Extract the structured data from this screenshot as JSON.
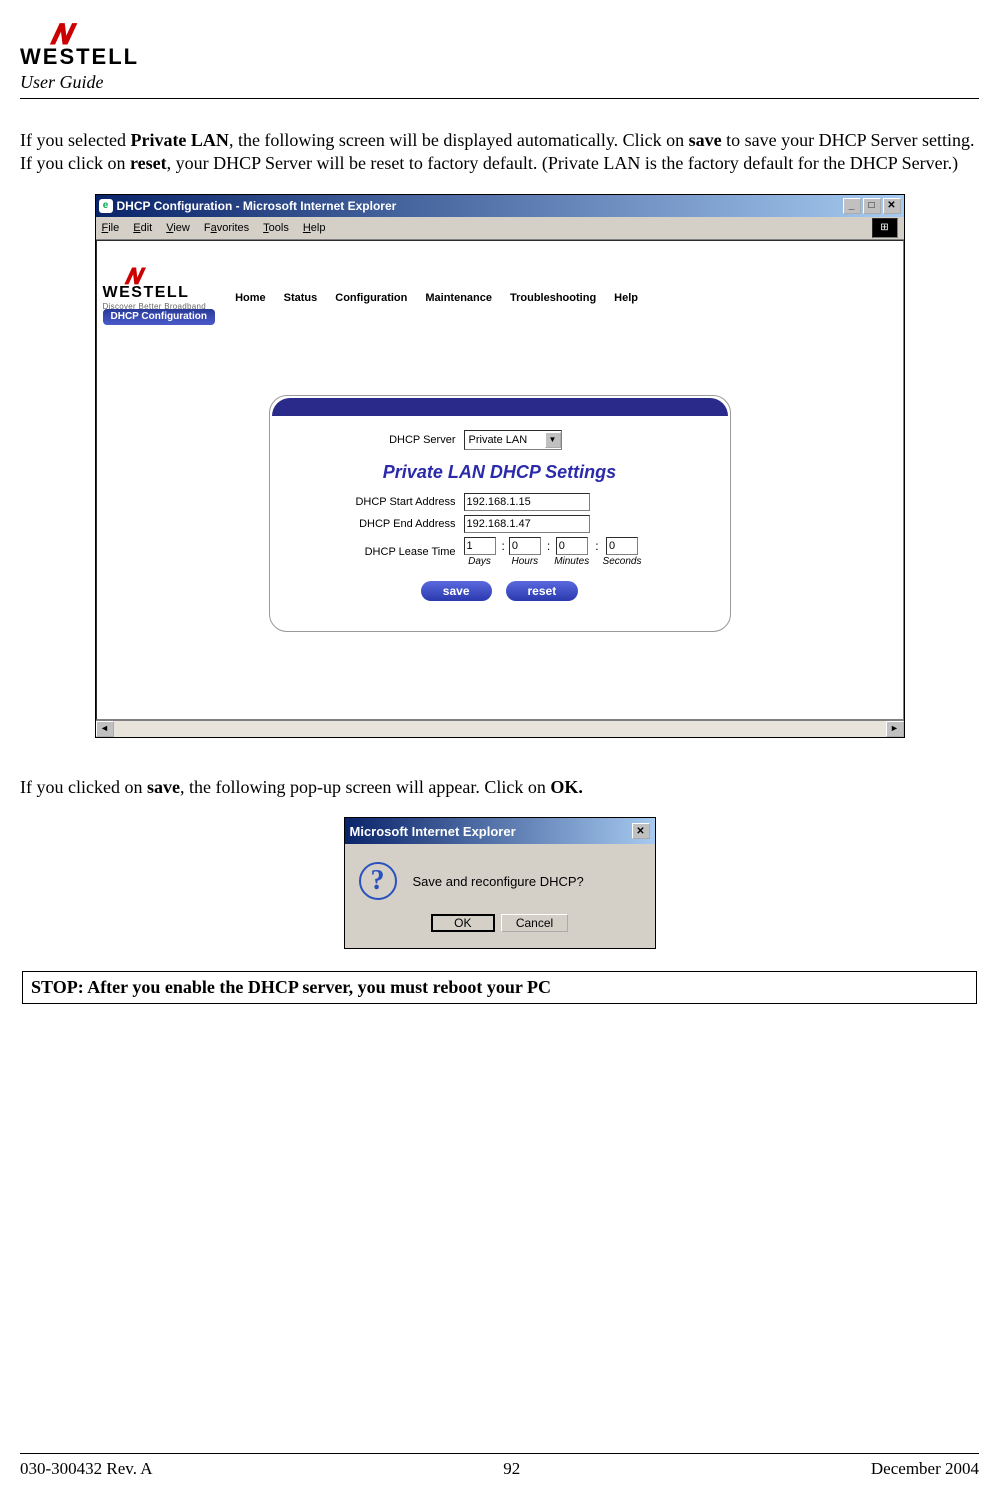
{
  "header": {
    "brand": "WESTELL",
    "doc_label": "User Guide"
  },
  "paragraphs": {
    "p1_pre": "If you selected ",
    "p1_b1": "Private LAN",
    "p1_mid1": ", the following screen will be displayed automatically. Click on ",
    "p1_b2": "save",
    "p1_mid2": " to save your DHCP Server setting. If you click on ",
    "p1_b3": "reset",
    "p1_post": ", your DHCP Server will be reset to factory default. (Private LAN is the factory default for the DHCP Server.)",
    "p2_pre": "If you clicked on ",
    "p2_b1": "save",
    "p2_mid": ", the following pop-up screen will appear. Click on ",
    "p2_b2": "OK."
  },
  "stop_note": "STOP: After you enable the DHCP server, you must reboot your PC",
  "ie_window": {
    "title": "DHCP Configuration - Microsoft Internet Explorer",
    "menus": {
      "file": "File",
      "edit": "Edit",
      "view": "View",
      "favorites": "Favorites",
      "tools": "Tools",
      "help": "Help"
    },
    "logo_brand": "WESTELL",
    "logo_tagline": "Discover Better Broadband",
    "nav": {
      "home": "Home",
      "status": "Status",
      "config": "Configuration",
      "maint": "Maintenance",
      "trouble": "Troubleshooting",
      "help": "Help"
    },
    "sub_tab": "DHCP Configuration",
    "panel": {
      "dhcp_server_label": "DHCP Server",
      "dhcp_server_value": "Private LAN",
      "heading": "Private LAN DHCP Settings",
      "start_label": "DHCP Start Address",
      "start_value": "192.168.1.15",
      "end_label": "DHCP End Address",
      "end_value": "192.168.1.47",
      "lease_label": "DHCP Lease Time",
      "lease": {
        "days": "1",
        "days_unit": "Days",
        "hours": "0",
        "hours_unit": "Hours",
        "minutes": "0",
        "minutes_unit": "Minutes",
        "seconds": "0",
        "seconds_unit": "Seconds"
      },
      "save_btn": "save",
      "reset_btn": "reset"
    }
  },
  "popup": {
    "title": "Microsoft Internet Explorer",
    "message": "Save and reconfigure DHCP?",
    "ok": "OK",
    "cancel": "Cancel"
  },
  "footer": {
    "left": "030-300432 Rev. A",
    "center": "92",
    "right": "December 2004"
  }
}
